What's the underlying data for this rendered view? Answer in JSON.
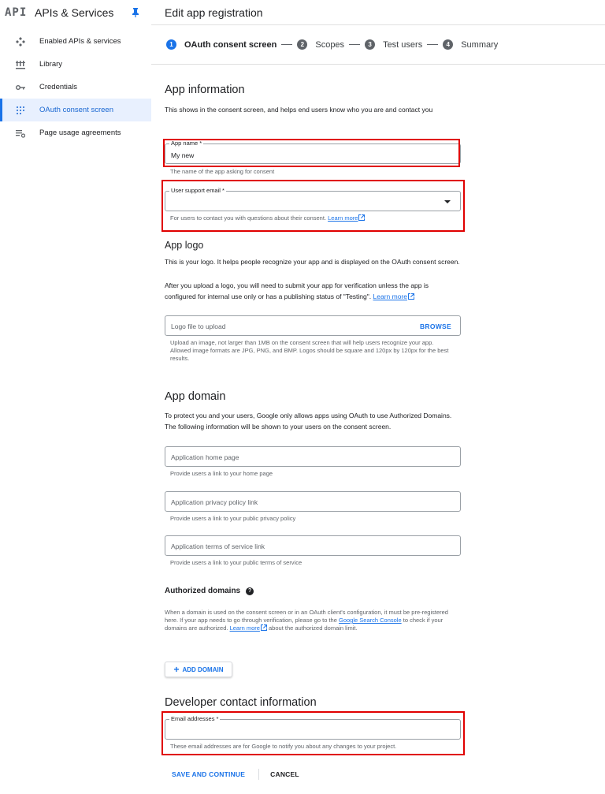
{
  "sidebar": {
    "logo": "API",
    "title": "APIs & Services",
    "items": [
      {
        "label": "Enabled APIs & services",
        "icon": "enabled-apis-icon",
        "active": false
      },
      {
        "label": "Library",
        "icon": "library-icon",
        "active": false
      },
      {
        "label": "Credentials",
        "icon": "key-icon",
        "active": false
      },
      {
        "label": "OAuth consent screen",
        "icon": "consent-icon",
        "active": true
      },
      {
        "label": "Page usage agreements",
        "icon": "agreements-icon",
        "active": false
      }
    ]
  },
  "header": {
    "title": "Edit app registration"
  },
  "stepper": {
    "steps": [
      {
        "num": "1",
        "label": "OAuth consent screen"
      },
      {
        "num": "2",
        "label": "Scopes"
      },
      {
        "num": "3",
        "label": "Test users"
      },
      {
        "num": "4",
        "label": "Summary"
      }
    ]
  },
  "app_info": {
    "heading": "App information",
    "desc": "This shows in the consent screen, and helps end users know who you are and contact you",
    "app_name": {
      "label": "App name *",
      "value": "My new",
      "hint": "The name of the app asking for consent"
    },
    "support_email": {
      "label": "User support email *",
      "value": "",
      "hint": "For users to contact you with questions about their consent.",
      "link": "Learn more"
    }
  },
  "app_logo": {
    "heading": "App logo",
    "desc1": "This is your logo. It helps people recognize your app and is displayed on the OAuth consent screen.",
    "desc2": "After you upload a logo, you will need to submit your app for verification unless the app is configured for internal use only or has a publishing status of \"Testing\".",
    "desc_link": "Learn more",
    "placeholder": "Logo file to upload",
    "browse": "BROWSE",
    "hint": "Upload an image, not larger than 1MB on the consent screen that will help users recognize your app. Allowed image formats are JPG, PNG, and BMP. Logos should be square and 120px by 120px for the best results."
  },
  "app_domain": {
    "heading": "App domain",
    "desc": "To protect you and your users, Google only allows apps using OAuth to use Authorized Domains. The following information will be shown to your users on the consent screen.",
    "home": {
      "placeholder": "Application home page",
      "hint": "Provide users a link to your home page"
    },
    "privacy": {
      "placeholder": "Application privacy policy link",
      "hint": "Provide users a link to your public privacy policy"
    },
    "tos": {
      "placeholder": "Application terms of service link",
      "hint": "Provide users a link to your public terms of service"
    }
  },
  "authorized_domains": {
    "heading": "Authorized domains",
    "help": "?",
    "text1": "When a domain is used on the consent screen or in an OAuth client's configuration, it must be pre-registered here. If your app needs to go through verification, please go to the",
    "link1": "Google Search Console",
    "text2": "to check if your domains are authorized.",
    "link2": "Learn more",
    "text3": "about the authorized domain limit.",
    "add_button": "ADD DOMAIN"
  },
  "developer": {
    "heading": "Developer contact information",
    "label": "Email addresses *",
    "hint": "These email addresses are for Google to notify you about any changes to your project."
  },
  "actions": {
    "save": "SAVE AND CONTINUE",
    "cancel": "CANCEL"
  },
  "colors": {
    "accent": "#1a73e8",
    "highlight": "#e00000",
    "active_bg": "#e8f0fe"
  }
}
